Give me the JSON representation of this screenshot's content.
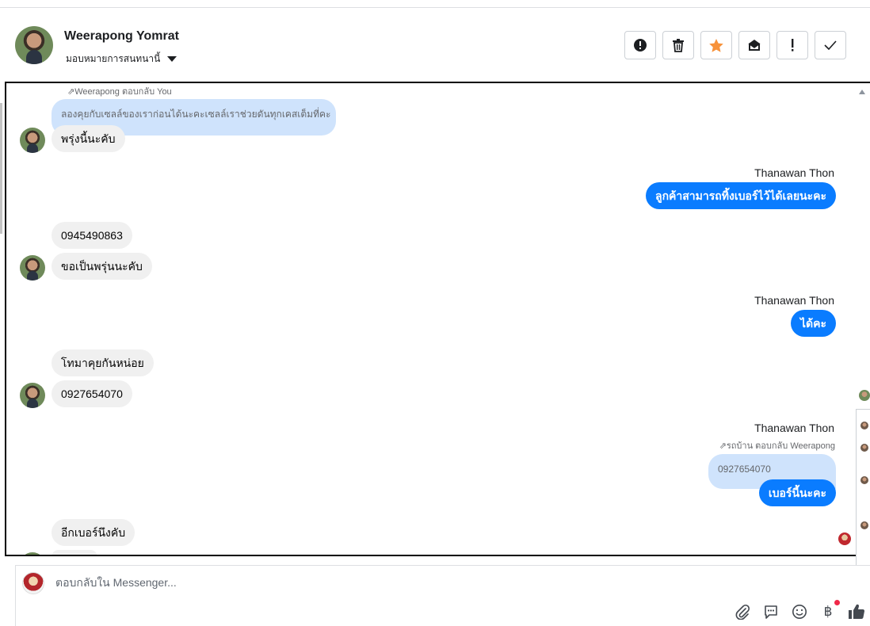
{
  "header": {
    "contact_name": "Weerapong Yomrat",
    "assign_label": "มอบหมายการสนทนานี้",
    "toolbar": [
      {
        "name": "mark-spam",
        "icon": "alert-circle-icon"
      },
      {
        "name": "delete",
        "icon": "trash-icon"
      },
      {
        "name": "star",
        "icon": "star-icon",
        "color": "#f7923a"
      },
      {
        "name": "mark-unread",
        "icon": "envelope-icon"
      },
      {
        "name": "follow-up",
        "icon": "exclamation-icon"
      },
      {
        "name": "mark-done",
        "icon": "check-icon"
      }
    ]
  },
  "messages": {
    "m1_reply_meta": "Weerapong ตอบกลับ You",
    "m1_quote": "ลองคุยกับเซลล์ของเราก่อนได้นะคะเซลล์เราช่วยดันทุกเคสเต็มที่คะ",
    "m1_text": "พรุ่งนี้นะคับ",
    "m2_sender": "Thanawan Thon",
    "m2_text": "ลูกค้าสามารถทิ้งเบอร์ไว้ได้เลยนะคะ",
    "m3_text": "0945490863",
    "m4_text": "ขอเป็นพรุ่นนะคับ",
    "m5_sender": "Thanawan Thon",
    "m5_text": "ได้คะ",
    "m6_text": "โทมาคุยกันหน่อย",
    "m7_text": "0927654070",
    "m8_sender": "Thanawan Thon",
    "m8_reply_meta": "รถบ้าน ตอบกลับ Weerapong",
    "m8_quote": "0927654070",
    "m8_text": "เบอร์นี้นะคะ",
    "m9_text": "อีกเบอร์นึงคับ"
  },
  "composer": {
    "placeholder": "ตอบกลับใน Messenger...",
    "icons": [
      "paperclip-icon",
      "saved-reply-icon",
      "emoji-icon",
      "baht-icon",
      "thumbs-up-icon"
    ],
    "baht_symbol": "฿",
    "accent": "#0a7cff"
  }
}
